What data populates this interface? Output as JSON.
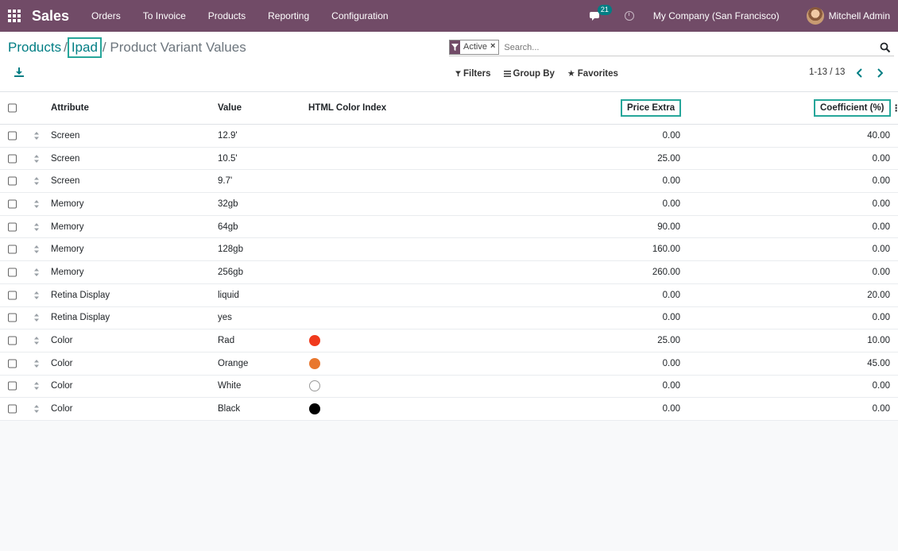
{
  "navbar": {
    "brand": "Sales",
    "menu": [
      "Orders",
      "To Invoice",
      "Products",
      "Reporting",
      "Configuration"
    ],
    "chat_badge": "21",
    "company": "My Company (San Francisco)",
    "user": "Mitchell Admin"
  },
  "breadcrumb": {
    "root": "Products",
    "sep": "/",
    "parent": "Ipad",
    "current": "/ Product Variant Values"
  },
  "search": {
    "facet": "Active",
    "facet_close": "×",
    "placeholder": "Search..."
  },
  "filters": {
    "filters_label": "Filters",
    "group_by_label": "Group By",
    "favorites_label": "Favorites"
  },
  "pager": {
    "text": "1-13 / 13"
  },
  "table": {
    "headers": {
      "attribute": "Attribute",
      "value": "Value",
      "html_color": "HTML Color Index",
      "price_extra": "Price Extra",
      "coefficient": "Coefficient (%)"
    },
    "rows": [
      {
        "attribute": "Screen",
        "value": "12.9'",
        "color": "",
        "price_extra": "0.00",
        "coefficient": "40.00"
      },
      {
        "attribute": "Screen",
        "value": "10.5'",
        "color": "",
        "price_extra": "25.00",
        "coefficient": "0.00"
      },
      {
        "attribute": "Screen",
        "value": "9.7'",
        "color": "",
        "price_extra": "0.00",
        "coefficient": "0.00"
      },
      {
        "attribute": "Memory",
        "value": "32gb",
        "color": "",
        "price_extra": "0.00",
        "coefficient": "0.00"
      },
      {
        "attribute": "Memory",
        "value": "64gb",
        "color": "",
        "price_extra": "90.00",
        "coefficient": "0.00"
      },
      {
        "attribute": "Memory",
        "value": "128gb",
        "color": "",
        "price_extra": "160.00",
        "coefficient": "0.00"
      },
      {
        "attribute": "Memory",
        "value": "256gb",
        "color": "",
        "price_extra": "260.00",
        "coefficient": "0.00"
      },
      {
        "attribute": "Retina Display",
        "value": "liquid",
        "color": "",
        "price_extra": "0.00",
        "coefficient": "20.00"
      },
      {
        "attribute": "Retina Display",
        "value": "yes",
        "color": "",
        "price_extra": "0.00",
        "coefficient": "0.00"
      },
      {
        "attribute": "Color",
        "value": "Rad",
        "color": "#f03a1d",
        "price_extra": "25.00",
        "coefficient": "10.00"
      },
      {
        "attribute": "Color",
        "value": "Orange",
        "color": "#e8772e",
        "price_extra": "0.00",
        "coefficient": "45.00"
      },
      {
        "attribute": "Color",
        "value": "White",
        "color": "#ffffff",
        "price_extra": "0.00",
        "coefficient": "0.00"
      },
      {
        "attribute": "Color",
        "value": "Black",
        "color": "#000000",
        "price_extra": "0.00",
        "coefficient": "0.00"
      }
    ]
  },
  "colors": {
    "navbar": "#714b67",
    "accent": "#017e84",
    "highlight": "#26a69a"
  }
}
